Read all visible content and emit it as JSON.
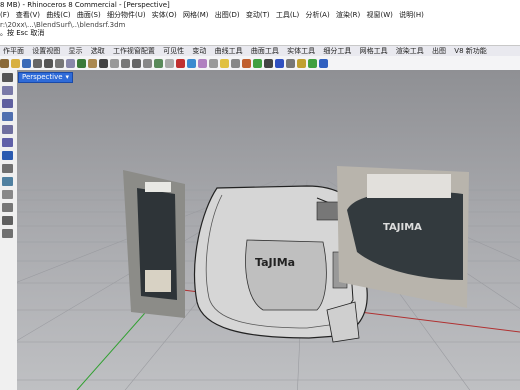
{
  "window": {
    "title": "8 MB) - Rhinoceros 8 Commercial - [Perspective]"
  },
  "menu": [
    "(F)",
    "查看(V)",
    "曲线(C)",
    "曲面(S)",
    "细分物件(U)",
    "实体(O)",
    "网格(M)",
    "出图(D)",
    "变动(T)",
    "工具(L)",
    "分析(A)",
    "渲染(R)",
    "视窗(W)",
    "说明(H)"
  ],
  "command": {
    "history": "r:\\20xx\\...\\BlendSurf\\..\\blendsrf.3dm",
    "prompt": "。按 Esc 取消"
  },
  "tabs": [
    "作平面",
    "设置视图",
    "显示",
    "选取",
    "工作视窗配置",
    "可见性",
    "变动",
    "曲线工具",
    "曲面工具",
    "实体工具",
    "细分工具",
    "网格工具",
    "渲染工具",
    "出图",
    "V8 新功能"
  ],
  "viewport": {
    "label": "Perspective",
    "arrow": "▾",
    "model_text": "TaJIMa",
    "photo_right_text": "TAJIMA"
  },
  "colors": {
    "viewport_top": "#8f9094",
    "viewport_bottom": "#bfc0c3",
    "grid_line": "#9a9ba0",
    "axis_red": "#b03030",
    "axis_green": "#30a030",
    "active_tab": "#2f6bd8"
  }
}
